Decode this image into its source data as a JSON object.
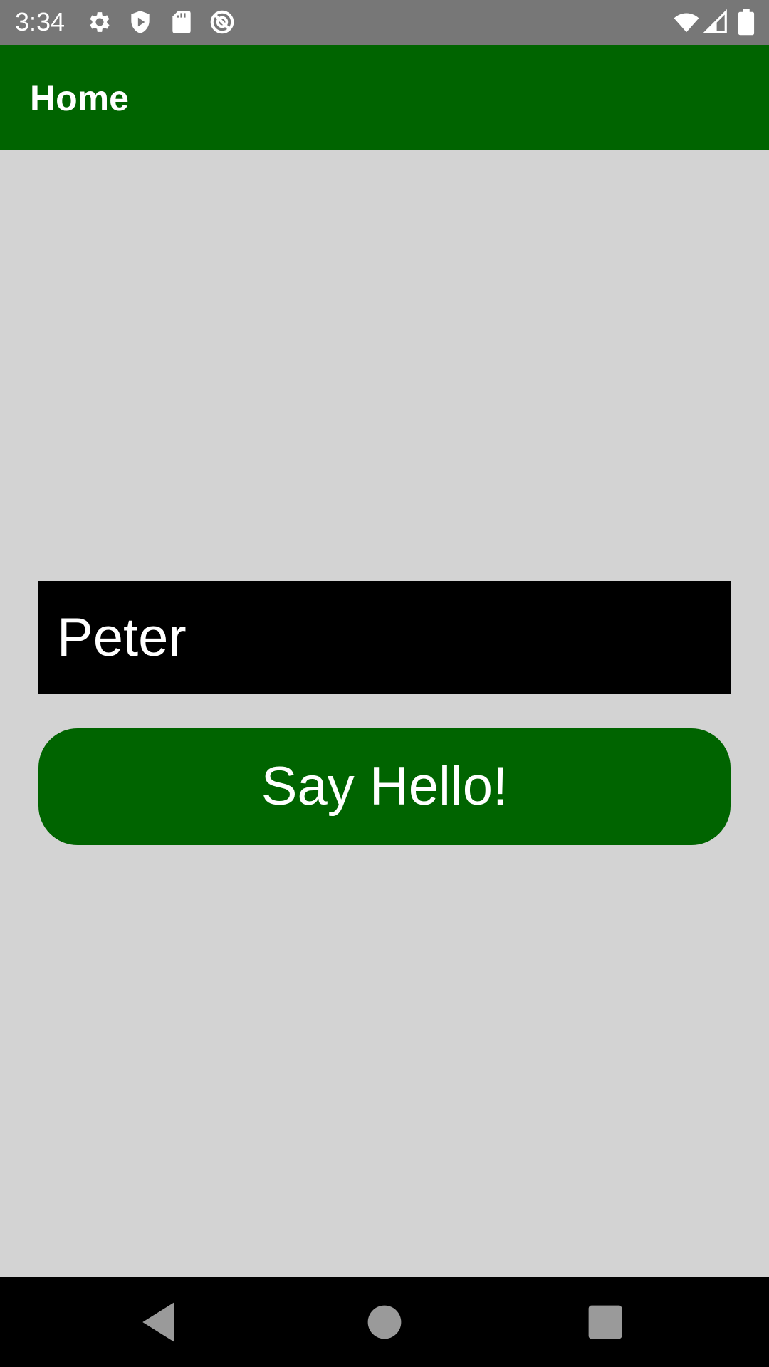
{
  "status_bar": {
    "time": "3:34",
    "icons_left": [
      "gear-icon",
      "shield-play-icon",
      "sd-card-icon",
      "no-disturb-icon"
    ],
    "icons_right": [
      "wifi-icon",
      "cell-signal-icon",
      "battery-icon"
    ],
    "background_color": "#777777"
  },
  "app_bar": {
    "title": "Home",
    "background_color": "#006400"
  },
  "main": {
    "name_input": {
      "value": "Peter",
      "background_color": "#000000",
      "text_color": "#ffffff"
    },
    "hello_button": {
      "label": "Say Hello!",
      "background_color": "#006400",
      "text_color": "#ffffff"
    },
    "background_color": "#d3d3d3"
  },
  "nav_bar": {
    "buttons": [
      "back-icon",
      "home-icon",
      "recents-icon"
    ],
    "icon_color": "#9a9a9a"
  }
}
